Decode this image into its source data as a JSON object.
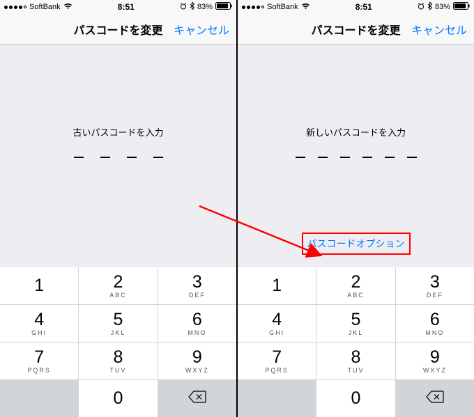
{
  "status": {
    "carrier": "SoftBank",
    "wifi_glyph": "≈",
    "time": "8:51",
    "alarm_glyph": "⏰",
    "bt_glyph": "࿆",
    "battery_pct": "83%"
  },
  "nav": {
    "title": "パスコードを変更",
    "cancel": "キャンセル"
  },
  "left": {
    "prompt": "古いパスコードを入力",
    "digit_count": 4
  },
  "right": {
    "prompt": "新しいパスコードを入力",
    "digit_count": 6,
    "options_label": "パスコードオプション"
  },
  "keypad": {
    "keys": [
      {
        "digit": "1",
        "letters": ""
      },
      {
        "digit": "2",
        "letters": "ABC"
      },
      {
        "digit": "3",
        "letters": "DEF"
      },
      {
        "digit": "4",
        "letters": "GHI"
      },
      {
        "digit": "5",
        "letters": "JKL"
      },
      {
        "digit": "6",
        "letters": "MNO"
      },
      {
        "digit": "7",
        "letters": "PQRS"
      },
      {
        "digit": "8",
        "letters": "TUV"
      },
      {
        "digit": "9",
        "letters": "WXYZ"
      },
      {
        "digit": "0",
        "letters": ""
      }
    ]
  },
  "colors": {
    "accent": "#007aff",
    "highlight": "#ff0000"
  }
}
